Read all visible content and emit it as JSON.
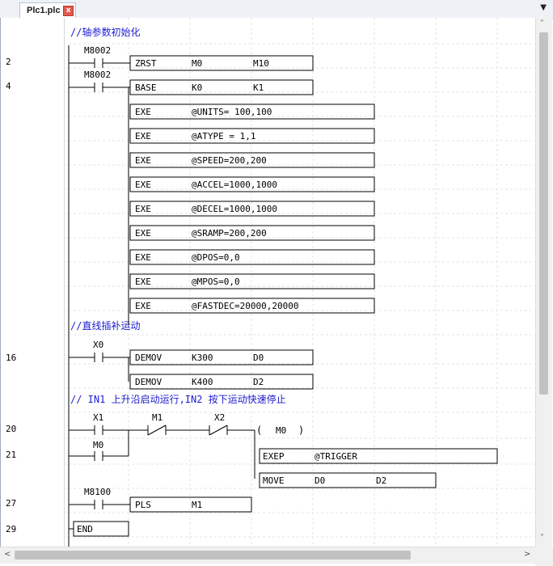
{
  "tab": {
    "title": "Plc1.plc",
    "close": "x",
    "dropdown": "▼"
  },
  "row_numbers": [
    "2",
    "4",
    "16",
    "20",
    "21",
    "27",
    "29"
  ],
  "comments": [
    "//轴参数初始化",
    "//直线插补运动",
    "// IN1 上升沿启动运行,IN2 按下运动快速停止"
  ],
  "contacts": [
    "M8002",
    "M8002",
    "X0",
    "X1",
    "M0",
    "M1",
    "X2",
    "M8100"
  ],
  "coil": {
    "name": "M0"
  },
  "instructions": [
    {
      "op": "ZRST",
      "args": [
        "M0",
        "M10"
      ]
    },
    {
      "op": "BASE",
      "args": [
        "K0",
        "K1"
      ]
    },
    {
      "op": "EXE",
      "args": [
        "@UNITS= 100,100"
      ]
    },
    {
      "op": "EXE",
      "args": [
        "@ATYPE = 1,1"
      ]
    },
    {
      "op": "EXE",
      "args": [
        "@SPEED=200,200"
      ]
    },
    {
      "op": "EXE",
      "args": [
        "@ACCEL=1000,1000"
      ]
    },
    {
      "op": "EXE",
      "args": [
        "@DECEL=1000,1000"
      ]
    },
    {
      "op": "EXE",
      "args": [
        "@SRAMP=200,200"
      ]
    },
    {
      "op": "EXE",
      "args": [
        "@DPOS=0,0"
      ]
    },
    {
      "op": "EXE",
      "args": [
        "@MPOS=0,0"
      ]
    },
    {
      "op": "EXE",
      "args": [
        "@FASTDEC=20000,20000"
      ]
    },
    {
      "op": "DEMOV",
      "args": [
        "K300",
        "D0"
      ]
    },
    {
      "op": "DEMOV",
      "args": [
        "K400",
        "D2"
      ]
    },
    {
      "op": "EXEP",
      "args": [
        "@TRIGGER"
      ]
    },
    {
      "op": "MOVE",
      "args": [
        "D0",
        "D2"
      ]
    },
    {
      "op": "PLS",
      "args": [
        "M1"
      ]
    },
    {
      "op": "END",
      "args": []
    }
  ],
  "scroll": {
    "up": "˄",
    "down": "˅",
    "left": "<",
    "right": ">"
  }
}
